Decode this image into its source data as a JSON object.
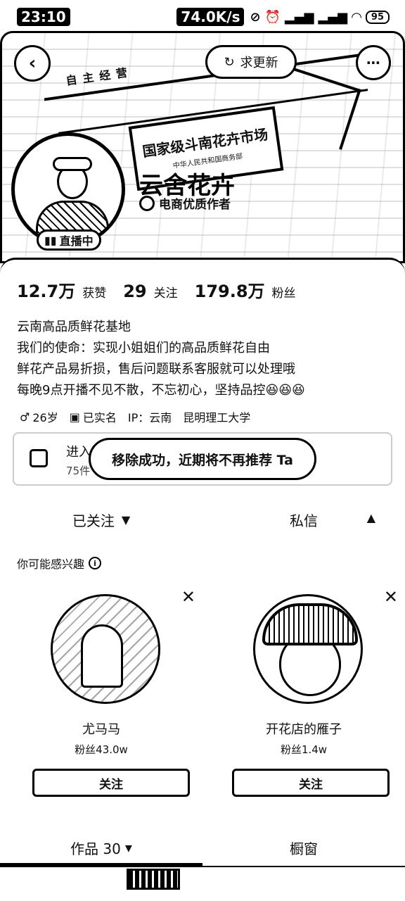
{
  "status_bar": {
    "time": "23:10",
    "speed": "74.0K/s",
    "battery": "95"
  },
  "header": {
    "back_icon": "back-arrow-icon",
    "request_update_label": "求更新",
    "more_icon": "more-dots-icon",
    "banner_sign_text": "国家级斗南花卉市场",
    "banner_sign_subtext": "中华人民共和国商务部",
    "banner_top_text": "自主经营"
  },
  "profile": {
    "name": "云舍花卉",
    "badge": "电商优质作者",
    "live_label": "直播中"
  },
  "stats": {
    "likes_value": "12.7万",
    "likes_label": "获赞",
    "following_value": "29",
    "following_label": "关注",
    "followers_value": "179.8万",
    "followers_label": "粉丝"
  },
  "bio": {
    "line1": "云南高品质鲜花基地",
    "line2": "我们的使命：实现小姐姐们的高品质鲜花自由",
    "line3": "鲜花产品易折损，售后问题联系客服就可以处理哦",
    "line4": "每晚9点开播不见不散，不忘初心，坚持品控😆😆😆"
  },
  "tags": {
    "age": "26岁",
    "verified": "已实名",
    "ip": "IP：云南",
    "school": "昆明理工大学"
  },
  "shop": {
    "title": "进入橱窗",
    "subtitle": "75件"
  },
  "toast": {
    "text": "移除成功，近期将不再推荐 Ta"
  },
  "actions": {
    "followed_label": "已关注",
    "message_label": "私信"
  },
  "suggestions": {
    "title": "你可能感兴趣",
    "items": [
      {
        "name": "尤马马",
        "fans": "粉丝43.0w",
        "follow_label": "关注"
      },
      {
        "name": "开花店的雁子",
        "fans": "粉丝1.4w",
        "follow_label": "关注"
      }
    ]
  },
  "tabs": {
    "works_label": "作品 30",
    "showcase_label": "橱窗"
  }
}
